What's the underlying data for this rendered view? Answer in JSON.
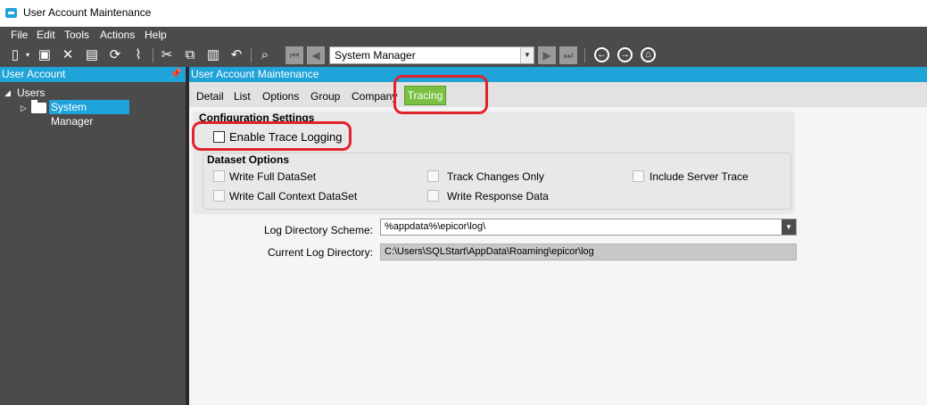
{
  "window": {
    "title": "User Account Maintenance"
  },
  "menu": [
    "File",
    "Edit",
    "Tools",
    "Actions",
    "Help"
  ],
  "toolbar": {
    "company_combo": "System Manager",
    "icons": [
      "new-icon",
      "save-icon",
      "delete-icon",
      "clipboard-icon",
      "refresh-icon",
      "clear-icon",
      "cut-icon",
      "copy-icon",
      "paste-icon",
      "undo-icon",
      "search-icon",
      "first-record-icon",
      "previous-record-icon",
      "next-record-icon",
      "last-record-icon",
      "back-icon",
      "forward-icon",
      "home-icon"
    ]
  },
  "left_panel": {
    "header": "User Account",
    "tree": {
      "root": "Users",
      "child": "System Manager"
    }
  },
  "main": {
    "header": "User Account Maintenance",
    "tabs": [
      "Detail",
      "List",
      "Options",
      "Group",
      "Company",
      "Tracing"
    ],
    "active_tab": "Tracing",
    "config": {
      "title": "Configuration Settings",
      "enable_trace": {
        "label": "Enable Trace Logging",
        "checked": false
      },
      "dataset": {
        "title": "Dataset Options",
        "options": [
          {
            "label": "Write Full DataSet",
            "checked": false
          },
          {
            "label": "Track Changes Only",
            "checked": false
          },
          {
            "label": "Include Server Trace",
            "checked": false
          },
          {
            "label": "Write Call Context DataSet",
            "checked": false
          },
          {
            "label": "Write Response Data",
            "checked": false
          }
        ]
      }
    },
    "log_scheme": {
      "label": "Log Directory Scheme:",
      "value": "%appdata%\\epicor\\log\\"
    },
    "current_log": {
      "label": "Current Log Directory:",
      "value": "C:\\Users\\SQLStart\\AppData\\Roaming\\epicor\\log"
    }
  },
  "colors": {
    "accent": "#1fa3d9",
    "tab_active": "#7ac043",
    "highlight_ring": "#e3222b",
    "dark_bg": "#4b4b4b"
  }
}
